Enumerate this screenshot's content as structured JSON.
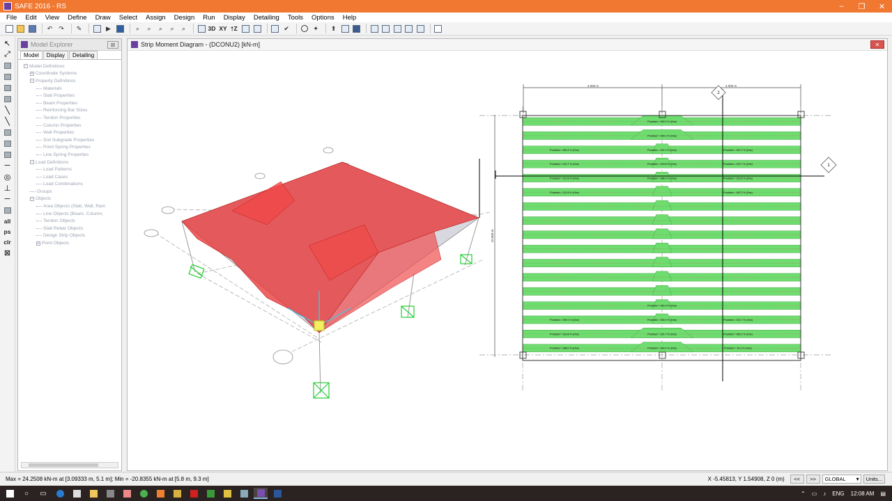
{
  "window": {
    "title": "SAFE 2016 - RS",
    "controls": [
      "–",
      "❐",
      "✕"
    ]
  },
  "menu": [
    "File",
    "Edit",
    "View",
    "Define",
    "Draw",
    "Select",
    "Assign",
    "Design",
    "Run",
    "Display",
    "Detailing",
    "Tools",
    "Options",
    "Help"
  ],
  "toolbar": {
    "view_3d": "3D",
    "view_xy": "XY",
    "view_tz": "†Z"
  },
  "left_tools": {
    "all": "all",
    "ps": "ps",
    "clr": "clr"
  },
  "explorer": {
    "title": "Model Explorer",
    "close": "⊠",
    "tabs": [
      "Model",
      "Display",
      "Detailing"
    ],
    "tree": [
      {
        "label": "Model Definitions",
        "level": 0,
        "toggle": "−"
      },
      {
        "label": "Coordinate Systems",
        "level": 1,
        "toggle": "+"
      },
      {
        "label": "Property Definitions",
        "level": 1,
        "toggle": "−"
      },
      {
        "label": "Materials",
        "level": 2,
        "toggle": ""
      },
      {
        "label": "Slab Properties",
        "level": 2,
        "toggle": ""
      },
      {
        "label": "Beam Properties",
        "level": 2,
        "toggle": ""
      },
      {
        "label": "Reinforcing Bar Sizes",
        "level": 2,
        "toggle": ""
      },
      {
        "label": "Tendon Properties",
        "level": 2,
        "toggle": ""
      },
      {
        "label": "Column Properties",
        "level": 2,
        "toggle": ""
      },
      {
        "label": "Wall Properties",
        "level": 2,
        "toggle": ""
      },
      {
        "label": "Soil Subgrade Properties",
        "level": 2,
        "toggle": ""
      },
      {
        "label": "Point Spring Properties",
        "level": 2,
        "toggle": ""
      },
      {
        "label": "Line Spring Properties",
        "level": 2,
        "toggle": ""
      },
      {
        "label": "Load Definitions",
        "level": 1,
        "toggle": "−"
      },
      {
        "label": "Load Patterns",
        "level": 2,
        "toggle": ""
      },
      {
        "label": "Load Cases",
        "level": 2,
        "toggle": ""
      },
      {
        "label": "Load Combinations",
        "level": 2,
        "toggle": ""
      },
      {
        "label": "Groups",
        "level": 1,
        "toggle": ""
      },
      {
        "label": "Objects",
        "level": 1,
        "toggle": "−"
      },
      {
        "label": "Area Objects (Slab, Wall, Ram",
        "level": 2,
        "toggle": ""
      },
      {
        "label": "Line Objects (Beam, Column,",
        "level": 2,
        "toggle": ""
      },
      {
        "label": "Tendon Objects",
        "level": 2,
        "toggle": ""
      },
      {
        "label": "Slab Rebar Objects",
        "level": 2,
        "toggle": ""
      },
      {
        "label": "Design Strip Objects",
        "level": 2,
        "toggle": ""
      },
      {
        "label": "Point Objects",
        "level": 2,
        "toggle": "+"
      }
    ]
  },
  "view": {
    "title": "Strip Moment Diagram   - (DCONU2)  [kN-m]",
    "close": "✕",
    "dim_top_left": "4.000 m",
    "dim_top_right": "4.000 m",
    "dim_side": "10.000 m",
    "grid_tags": [
      "A",
      "B",
      "C",
      "1",
      "2"
    ],
    "strip_labels": [
      "Provided = 353.3 % (One)",
      "Provided = 399.1 % (One)",
      "Provided = 353.3 % (One)",
      "Provided = 187.2 % (One)",
      "Provided = 187.2 % (One)",
      "Provided = 221.7 % (One)",
      "Provided = 319.8 % (One)",
      "Provided = 221.7 % (One)",
      "Provided = 212.8 % (One)",
      "Provided = 388.0 % (One)",
      "Provided = 212.8 % (One)",
      "Provided = 212.8 % (One)",
      "Provided = 187.2 % (One)",
      "Provided = 353.3 % (One)",
      "Provided = 399.1 % (One)",
      "Provided = 353.3 % (One)",
      "Provided = 221.7 % (One)",
      "Provided = 319.8 % (One)",
      "Provided = 221.7 % (One)",
      "Provided = 280.2 % (One)",
      "Provided = 388.0 % (One)",
      "Provided = 280.2 % (One)",
      "Provided = 30.3 % (One)",
      "Provided = 30.3 % (One)",
      "Provided = 187.2 % (One)",
      "Provided = 373.2 % (One)"
    ]
  },
  "status": {
    "left": "Max = 24.2508 kN-m at [3.09333 m, 5.1 m];  Min = -20.8355 kN-m at [5.8 m, 9.3 m]",
    "coords": "X -5.45813,  Y 1.54908,  Z 0  (m)",
    "prev": "<<",
    "next": ">>",
    "coord_system": "GLOBAL",
    "units": "Units..."
  },
  "taskbar": {
    "lang": "ENG",
    "time": "12:08 AM"
  },
  "colors": {
    "titlebar": "#f07830",
    "moment_red": "#e83030",
    "strip_green": "#6fdc6f",
    "support_green": "#22cc33"
  }
}
